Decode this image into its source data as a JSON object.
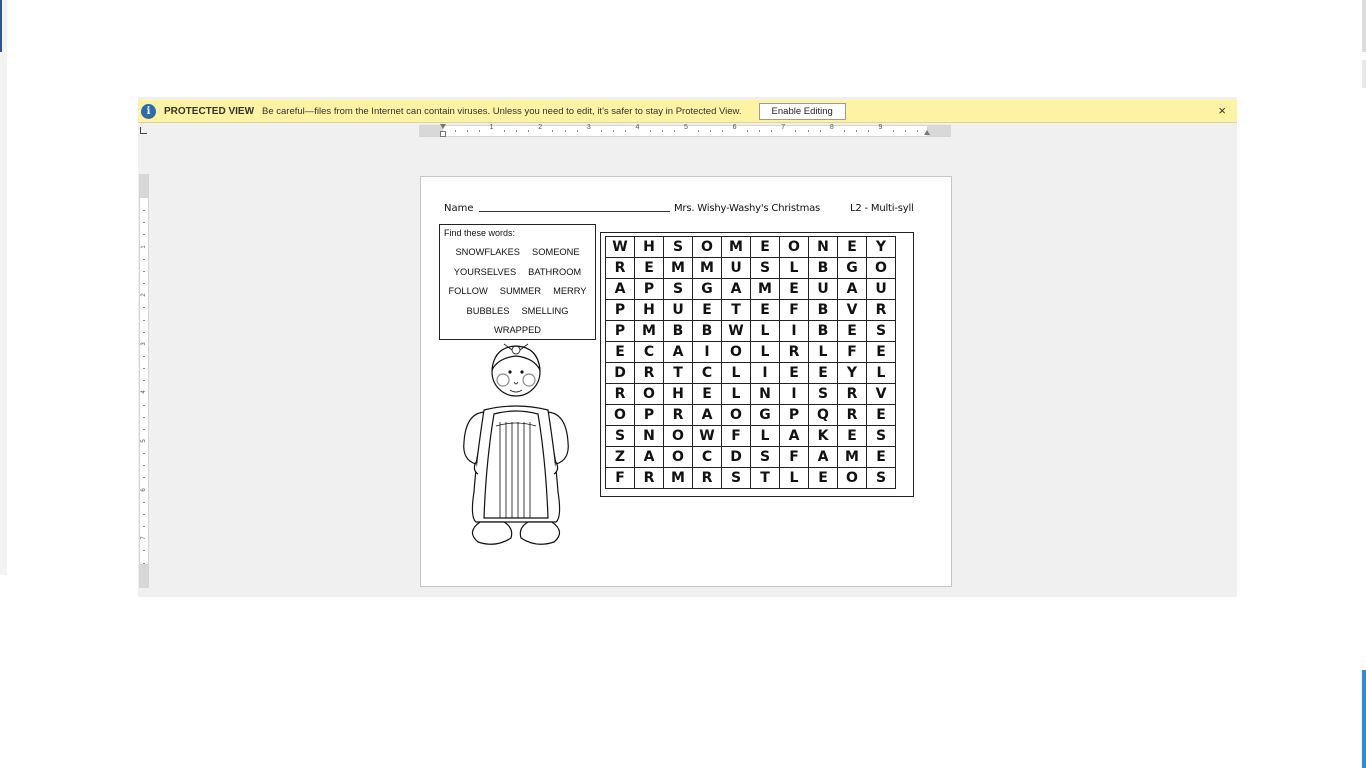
{
  "protected_view": {
    "title": "PROTECTED VIEW",
    "message": "Be careful—files from the Internet can contain viruses. Unless you need to edit, it's safer to stay in Protected View.",
    "enable_button": "Enable Editing",
    "close": "×"
  },
  "ruler": {
    "numbers": [
      "1",
      "2",
      "3",
      "4",
      "5",
      "6",
      "7",
      "8",
      "9"
    ],
    "vertical_numbers": [
      "1",
      "2",
      "3",
      "4",
      "5",
      "6",
      "7"
    ]
  },
  "worksheet": {
    "name_label": "Name",
    "title": "Mrs. Wishy-Washy's Christmas",
    "level": "L2 - Multi-syll",
    "find_label": "Find these words:",
    "word_rows": [
      [
        "SNOWFLAKES",
        "SOMEONE"
      ],
      [
        "YOURSELVES",
        "BATHROOM"
      ],
      [
        "FOLLOW",
        "SUMMER",
        "MERRY"
      ],
      [
        "BUBBLES",
        "SMELLING"
      ],
      [
        "WRAPPED"
      ]
    ],
    "grid": [
      [
        "W",
        "H",
        "S",
        "O",
        "M",
        "E",
        "O",
        "N",
        "E",
        "Y"
      ],
      [
        "R",
        "E",
        "M",
        "M",
        "U",
        "S",
        "L",
        "B",
        "G",
        "O"
      ],
      [
        "A",
        "P",
        "S",
        "G",
        "A",
        "M",
        "E",
        "U",
        "A",
        "U"
      ],
      [
        "P",
        "H",
        "U",
        "E",
        "T",
        "E",
        "F",
        "B",
        "V",
        "R"
      ],
      [
        "P",
        "M",
        "B",
        "B",
        "W",
        "L",
        "I",
        "B",
        "E",
        "S"
      ],
      [
        "E",
        "C",
        "A",
        "I",
        "O",
        "L",
        "R",
        "L",
        "F",
        "E"
      ],
      [
        "D",
        "R",
        "T",
        "C",
        "L",
        "I",
        "E",
        "E",
        "Y",
        "L"
      ],
      [
        "R",
        "O",
        "H",
        "E",
        "L",
        "N",
        "I",
        "S",
        "R",
        "V"
      ],
      [
        "O",
        "P",
        "R",
        "A",
        "O",
        "G",
        "P",
        "Q",
        "R",
        "E"
      ],
      [
        "S",
        "N",
        "O",
        "W",
        "F",
        "L",
        "A",
        "K",
        "E",
        "S"
      ],
      [
        "Z",
        "A",
        "O",
        "C",
        "D",
        "S",
        "F",
        "A",
        "M",
        "E"
      ],
      [
        "F",
        "R",
        "M",
        "R",
        "S",
        "T",
        "L",
        "E",
        "O",
        "S"
      ]
    ]
  },
  "icons": {
    "shield": "shield-info-icon",
    "close": "close-icon"
  },
  "colors": {
    "message_bar": "#fdf3a3",
    "shield": "#2b6cb0",
    "canvas": "#f0f0f0"
  }
}
